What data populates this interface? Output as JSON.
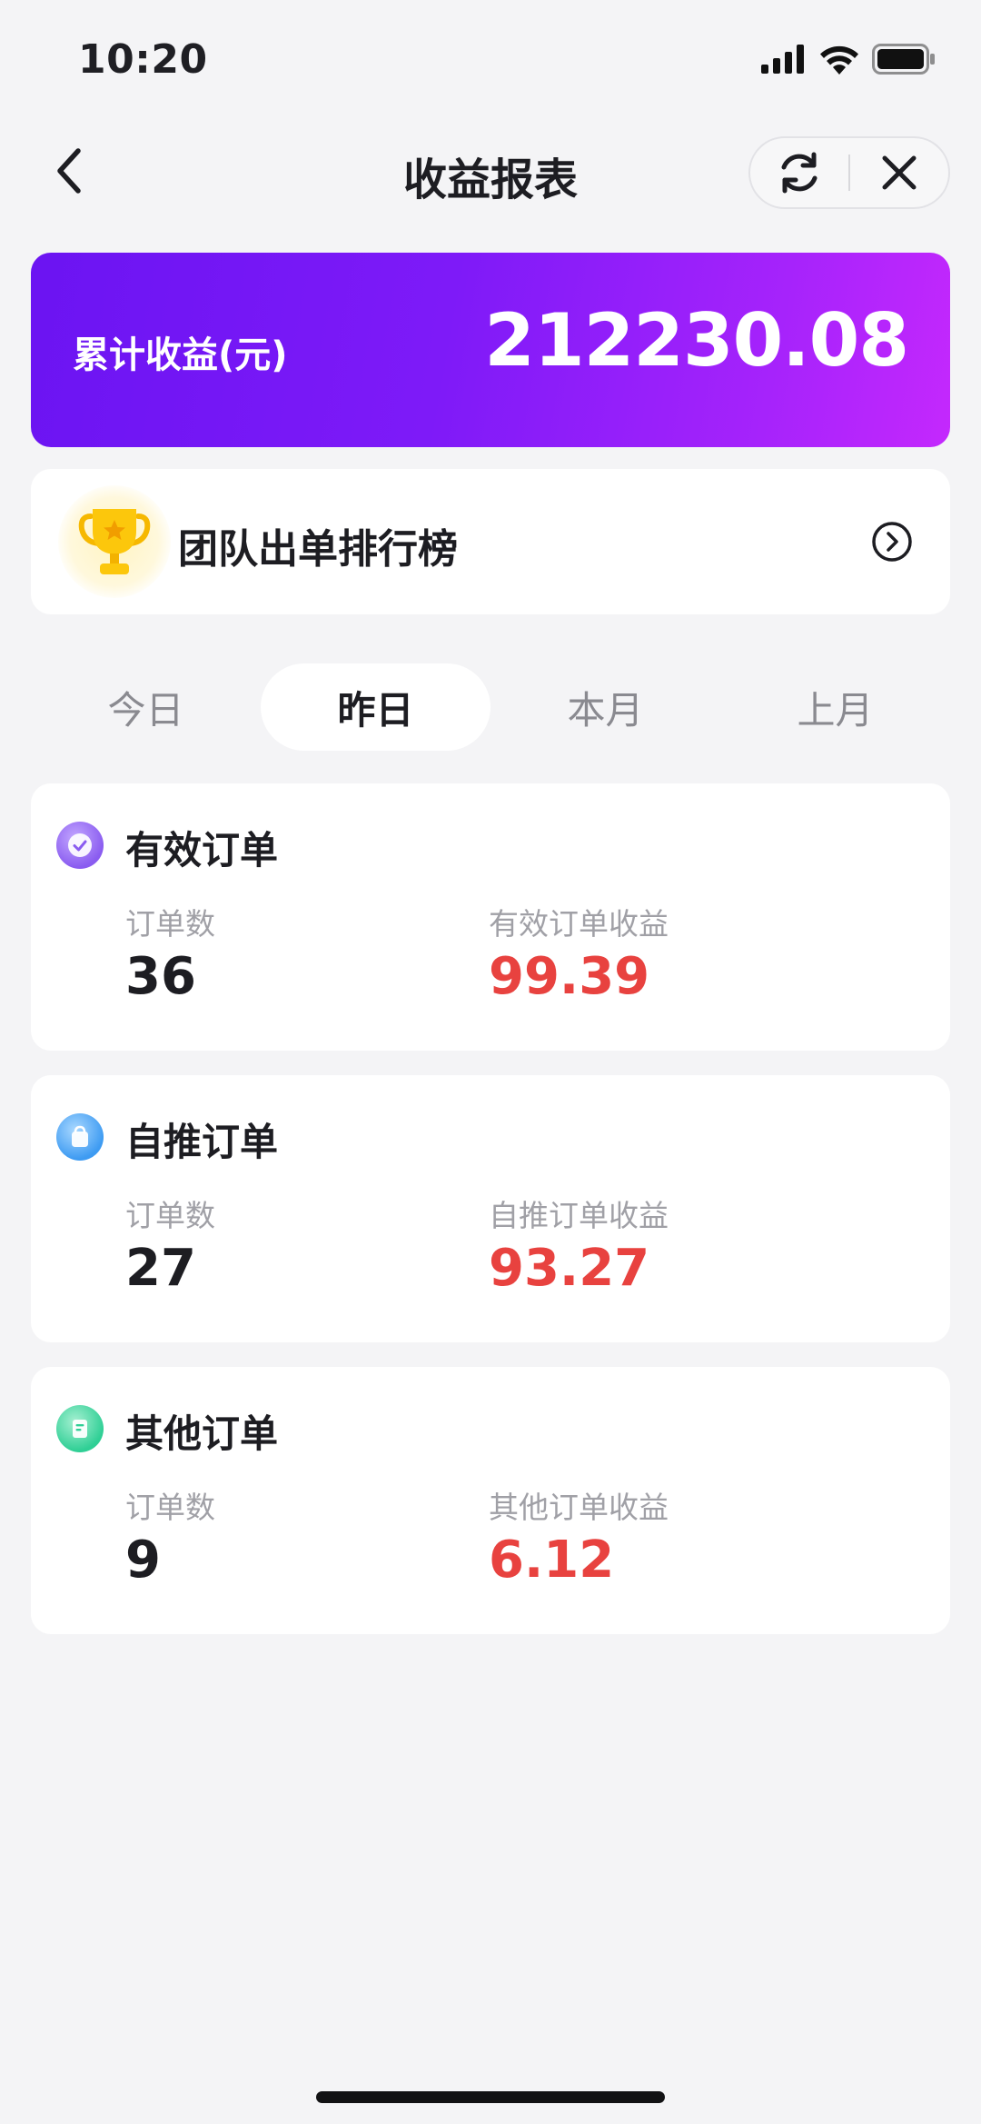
{
  "status_bar": {
    "time": "10:20"
  },
  "nav": {
    "title": "收益报表"
  },
  "earnings": {
    "label": "累计收益(元)",
    "value": "212230.08"
  },
  "ranking": {
    "title": "团队出单排行榜"
  },
  "tabs": [
    {
      "label": "今日"
    },
    {
      "label": "昨日"
    },
    {
      "label": "本月"
    },
    {
      "label": "上月"
    }
  ],
  "active_tab": "昨日",
  "orders": [
    {
      "title": "有效订单",
      "count_label": "订单数",
      "count": "36",
      "earn_label": "有效订单收益",
      "earn": "99.39",
      "icon": "check-circle-icon"
    },
    {
      "title": "自推订单",
      "count_label": "订单数",
      "count": "27",
      "earn_label": "自推订单收益",
      "earn": "93.27",
      "icon": "shopping-bag-icon"
    },
    {
      "title": "其他订单",
      "count_label": "订单数",
      "count": "9",
      "earn_label": "其他订单收益",
      "earn": "6.12",
      "icon": "document-icon"
    }
  ],
  "colors": {
    "banner_start": "#6b14f2",
    "banner_end": "#c428fd",
    "earn_red": "#e8423f",
    "background": "#f4f4f6"
  }
}
